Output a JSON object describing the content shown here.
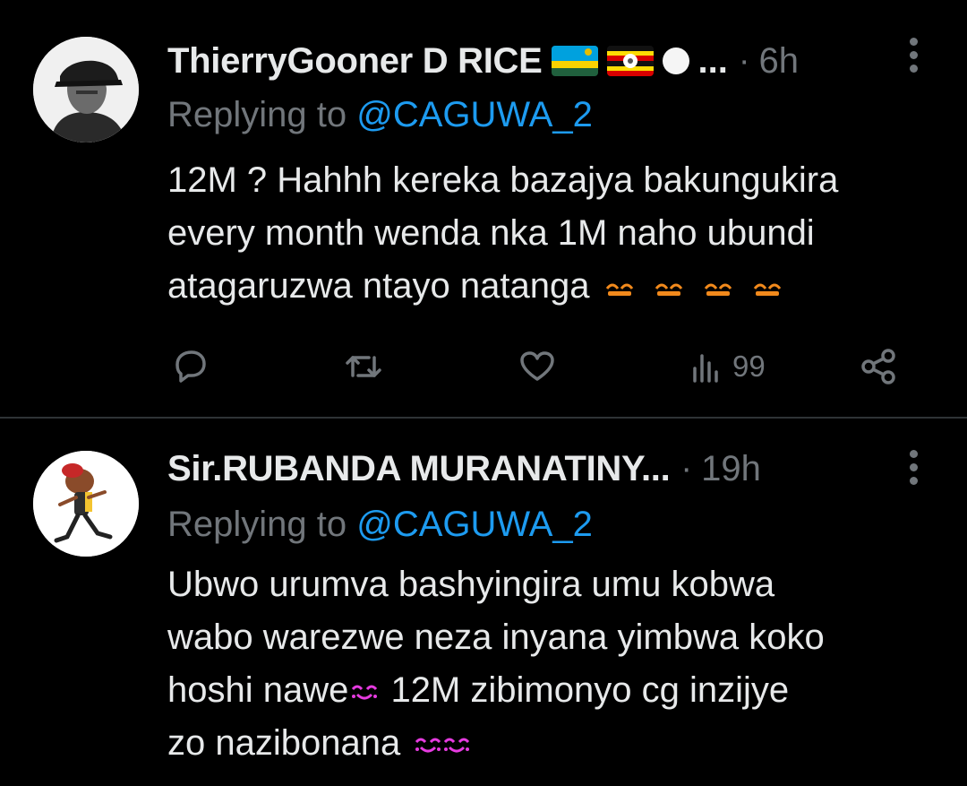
{
  "tweets": [
    {
      "display_name": "ThierryGooner D RICE",
      "name_ellipsis": "...",
      "separator": "·",
      "time": "6h",
      "replying_prefix": "Replying to",
      "replying_handle": "@CAGUWA_2",
      "text_lines": [
        "12M ? Hahhh kereka bazajya bakungukira",
        "every month wenda nka 1M naho ubundi",
        "atagaruzwa ntayo natanga"
      ],
      "badges": [
        "rwanda-flag-icon",
        "uganda-flag-icon",
        "white-circle-icon"
      ],
      "trailing_emojis": [
        "orange-emoji-icon",
        "orange-emoji-icon",
        "orange-emoji-icon",
        "orange-emoji-icon"
      ],
      "views": "99"
    },
    {
      "display_name": "Sir.RUBANDA MURANATINY...",
      "separator": "·",
      "time": "19h",
      "replying_prefix": "Replying to",
      "replying_handle": "@CAGUWA_2",
      "text_lines": [
        "Ubwo urumva bashyingira umu kobwa",
        "wabo warezwe neza inyana yimbwa koko"
      ],
      "line3_before": "hoshi nawe",
      "line3_after": " 12M zibimonyo cg inzijye",
      "line4": "zo nazibonana"
    }
  ],
  "colors": {
    "background": "#000000",
    "primary_text": "#e7e9ea",
    "secondary_text": "#71767b",
    "link": "#1d9bf0",
    "divider": "#2f3336",
    "emoji_orange": "#f28a1c",
    "emoji_pink": "#e63be0"
  }
}
